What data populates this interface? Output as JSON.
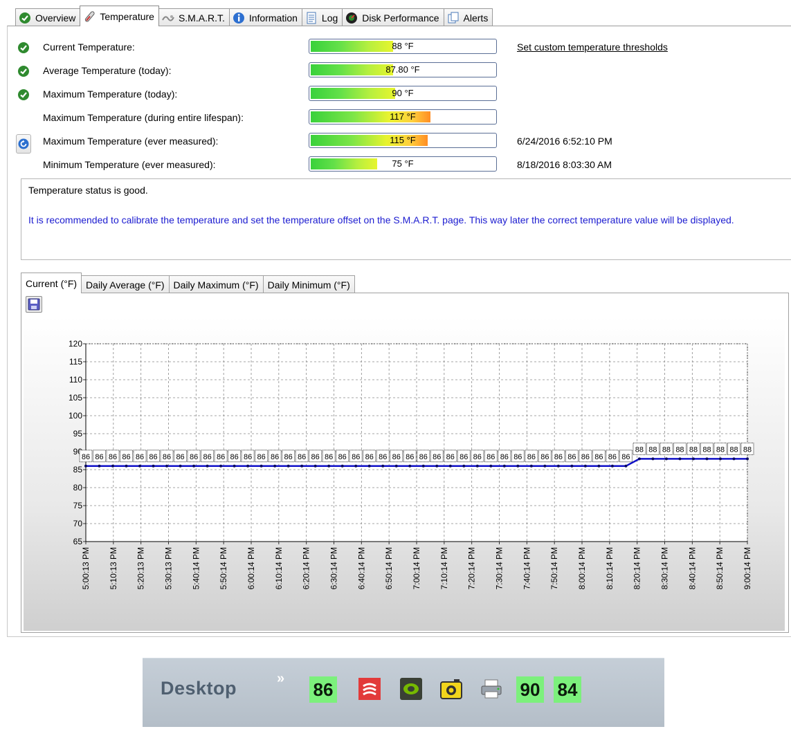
{
  "tabs": [
    {
      "label": "Overview",
      "icon": "check-circle-icon",
      "active": false
    },
    {
      "label": "Temperature",
      "icon": "thermometer-icon",
      "active": true
    },
    {
      "label": "S.M.A.R.T.",
      "icon": "smart-icon",
      "active": false
    },
    {
      "label": "Information",
      "icon": "info-icon",
      "active": false
    },
    {
      "label": "Log",
      "icon": "log-icon",
      "active": false
    },
    {
      "label": "Disk Performance",
      "icon": "disk-performance-icon",
      "active": false
    },
    {
      "label": "Alerts",
      "icon": "alerts-icon",
      "active": false
    }
  ],
  "temperatures": [
    {
      "label": "Current Temperature:",
      "value": "88 °F",
      "level": 0.445,
      "hot": false,
      "status": "ok",
      "aside": "Set custom temperature thresholds"
    },
    {
      "label": "Average Temperature (today):",
      "value": "87.80 °F",
      "level": 0.445,
      "hot": false,
      "status": "ok",
      "aside": ""
    },
    {
      "label": "Maximum Temperature (today):",
      "value": "90 °F",
      "level": 0.455,
      "hot": false,
      "status": "ok",
      "aside": ""
    },
    {
      "label": "Maximum Temperature (during entire lifespan):",
      "value": "117 °F",
      "level": 0.645,
      "hot": true,
      "status": "none",
      "aside": ""
    },
    {
      "label": "Maximum Temperature (ever measured):",
      "value": "115 °F",
      "level": 0.63,
      "hot": true,
      "status": "none",
      "aside": "6/24/2016 6:52:10 PM"
    },
    {
      "label": "Minimum Temperature (ever measured):",
      "value": "75 °F",
      "level": 0.36,
      "hot": false,
      "status": "none",
      "aside": "8/18/2016 8:03:30 AM"
    }
  ],
  "status": {
    "line1": "Temperature status is good.",
    "line2": "It is recommended to calibrate the temperature and set the temperature offset on the S.M.A.R.T. page. This way later the correct temperature value will be displayed."
  },
  "chart_tabs": [
    "Current (°F)",
    "Daily Average (°F)",
    "Daily Maximum (°F)",
    "Daily Minimum (°F)"
  ],
  "chart_data": {
    "type": "line",
    "title": "",
    "xlabel": "",
    "ylabel": "",
    "ylim": [
      65,
      120
    ],
    "yticks": [
      65,
      70,
      75,
      80,
      85,
      90,
      95,
      100,
      105,
      110,
      115,
      120
    ],
    "xtick_labels": [
      "5:00:13 PM",
      "5:10:13 PM",
      "5:20:13 PM",
      "5:30:13 PM",
      "5:40:14 PM",
      "5:50:14 PM",
      "6:00:14 PM",
      "6:10:14 PM",
      "6:20:14 PM",
      "6:30:14 PM",
      "6:40:14 PM",
      "6:50:14 PM",
      "7:00:14 PM",
      "7:10:14 PM",
      "7:20:14 PM",
      "7:30:14 PM",
      "7:40:14 PM",
      "7:50:14 PM",
      "8:00:14 PM",
      "8:10:14 PM",
      "8:20:14 PM",
      "8:30:14 PM",
      "8:40:14 PM",
      "8:50:14 PM",
      "9:00:14 PM"
    ],
    "grid": true,
    "series": [
      {
        "values": [
          86,
          86,
          86,
          86,
          86,
          86,
          86,
          86,
          86,
          86,
          86,
          86,
          86,
          86,
          86,
          86,
          86,
          86,
          86,
          86,
          86,
          86,
          86,
          86,
          86,
          86,
          86,
          86,
          86,
          86,
          86,
          86,
          86,
          86,
          86,
          86,
          86,
          86,
          86,
          86,
          86,
          88,
          88,
          88,
          88,
          88,
          88,
          88,
          88,
          88
        ],
        "color": "#1010c8",
        "point_labels": [
          "86",
          "86",
          "86",
          "86",
          "86",
          "86",
          "86",
          "86",
          "86",
          "86",
          "86",
          "86",
          "86",
          "86",
          "86",
          "86",
          "86",
          "86",
          "86",
          "86",
          "86",
          "86",
          "86",
          "86",
          "86",
          "86",
          "86",
          "86",
          "86",
          "86",
          "86",
          "86",
          "86",
          "86",
          "86",
          "86",
          "86",
          "86",
          "86",
          "86",
          "86",
          "88",
          "88",
          "88",
          "88",
          "88",
          "88",
          "88",
          "88",
          "88"
        ]
      }
    ]
  },
  "taskbar": {
    "desktop_label": "Desktop",
    "chevron": "»",
    "tray": [
      {
        "type": "number",
        "text": "86"
      },
      {
        "type": "icon",
        "icon": "red-app-icon"
      },
      {
        "type": "icon",
        "icon": "nvidia-icon"
      },
      {
        "type": "icon",
        "icon": "camera-icon"
      },
      {
        "type": "icon",
        "icon": "printer-icon"
      },
      {
        "type": "number",
        "text": "90"
      },
      {
        "type": "number",
        "text": "84"
      }
    ]
  }
}
